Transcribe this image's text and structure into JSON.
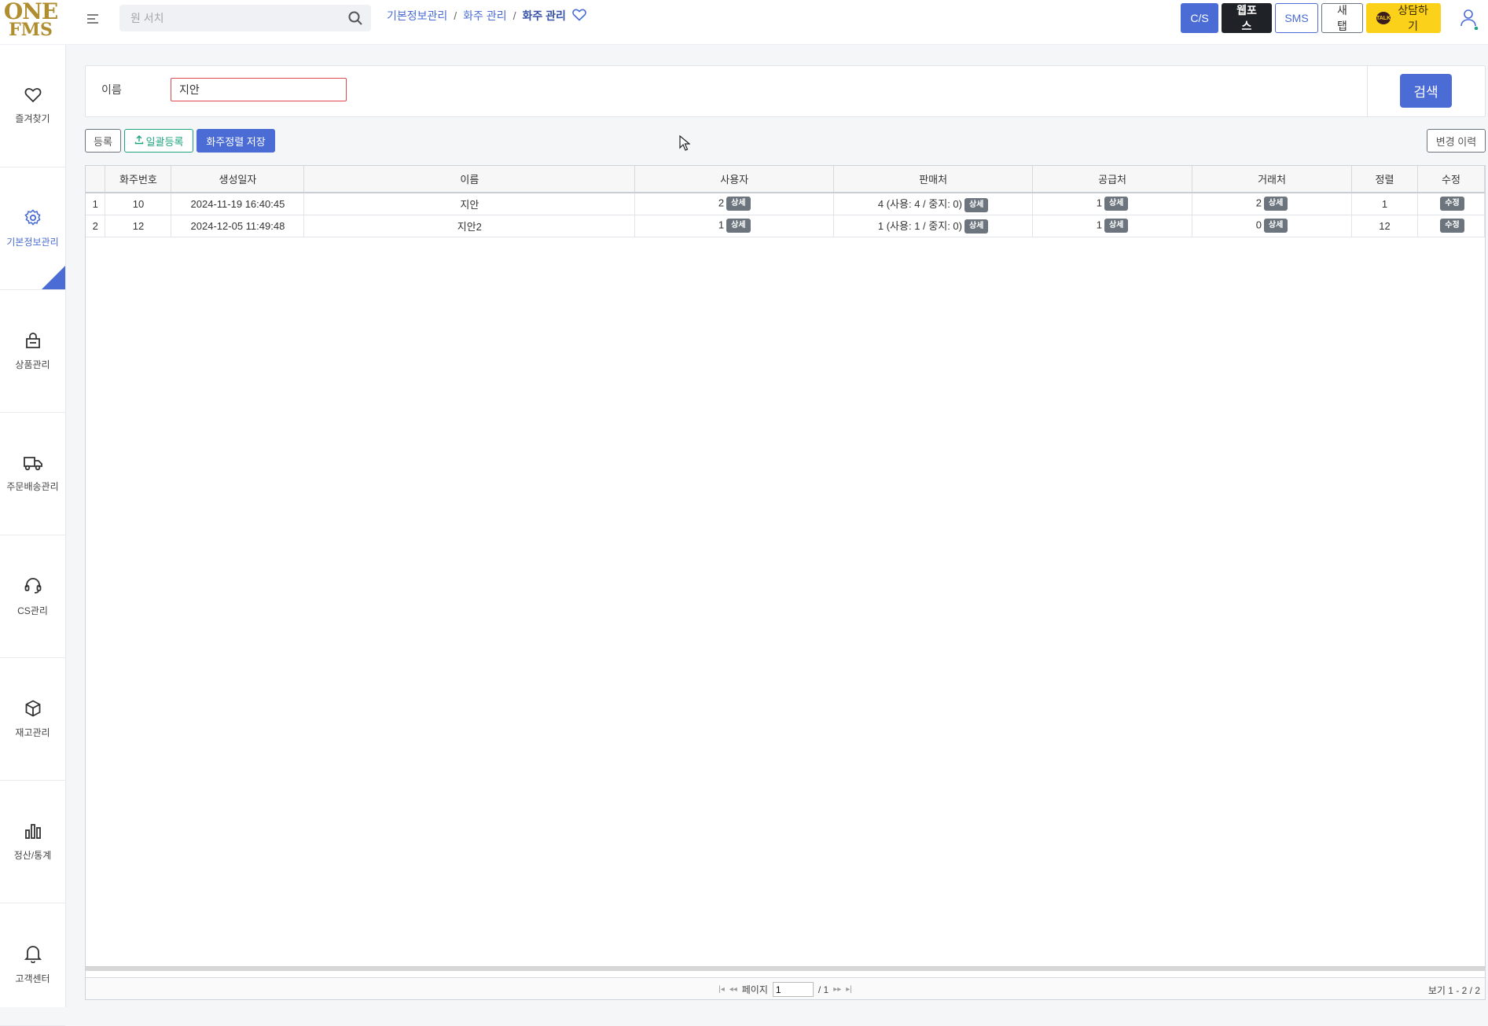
{
  "app": {
    "logo_line1": "ONE",
    "logo_line2": "FMS"
  },
  "header": {
    "search_placeholder": "원 서치",
    "breadcrumb": [
      "기본정보관리",
      "화주 관리",
      "화주 관리"
    ],
    "buttons": {
      "cs": "C/S",
      "webpos": "웹포스",
      "sms": "SMS",
      "newtab": "새 탭",
      "kakao_talk": "TALK",
      "kakao": "상담하기"
    }
  },
  "sidebar": {
    "items": [
      {
        "label": "즐겨찾기",
        "icon": "heart-icon"
      },
      {
        "label": "기본정보관리",
        "icon": "gear-icon",
        "active": true
      },
      {
        "label": "상품관리",
        "icon": "shopping-bag-icon"
      },
      {
        "label": "주문배송관리",
        "icon": "truck-icon"
      },
      {
        "label": "CS관리",
        "icon": "headset-icon"
      },
      {
        "label": "재고관리",
        "icon": "box-icon"
      },
      {
        "label": "정산/통계",
        "icon": "bar-chart-icon"
      },
      {
        "label": "고객센터",
        "icon": "bell-icon"
      }
    ]
  },
  "filter": {
    "name_label": "이름",
    "name_value": "지안",
    "search_button": "검색"
  },
  "actions": {
    "register": "등록",
    "bulk_register": "일괄등록",
    "save_order": "화주정렬 저장",
    "change_history": "변경 이력"
  },
  "table": {
    "columns": [
      "화주번호",
      "생성일자",
      "이름",
      "사용자",
      "판매처",
      "공급처",
      "거래처",
      "정렬",
      "수정"
    ],
    "detail_label": "상세",
    "edit_label": "수정",
    "rows": [
      {
        "rownum": "1",
        "id": "10",
        "created": "2024-11-19 16:40:45",
        "name": "지안",
        "users": "2",
        "sellers": "4 (사용: 4 / 중지: 0)",
        "suppliers": "1",
        "partners": "2",
        "sort": "1"
      },
      {
        "rownum": "2",
        "id": "12",
        "created": "2024-12-05 11:49:48",
        "name": "지안2",
        "users": "1",
        "sellers": "1 (사용: 1 / 중지: 0)",
        "suppliers": "1",
        "partners": "0",
        "sort": "12"
      }
    ]
  },
  "pager": {
    "page_label": "페이지",
    "page_value": "1",
    "page_total": "/ 1",
    "range": "보기 1 - 2 / 2"
  },
  "colors": {
    "primary": "#4a6cd4",
    "brand_gold": "#b08d2e",
    "kakao": "#fbd11a",
    "bulk_green": "#20a37f",
    "required_red": "#e0484f"
  }
}
